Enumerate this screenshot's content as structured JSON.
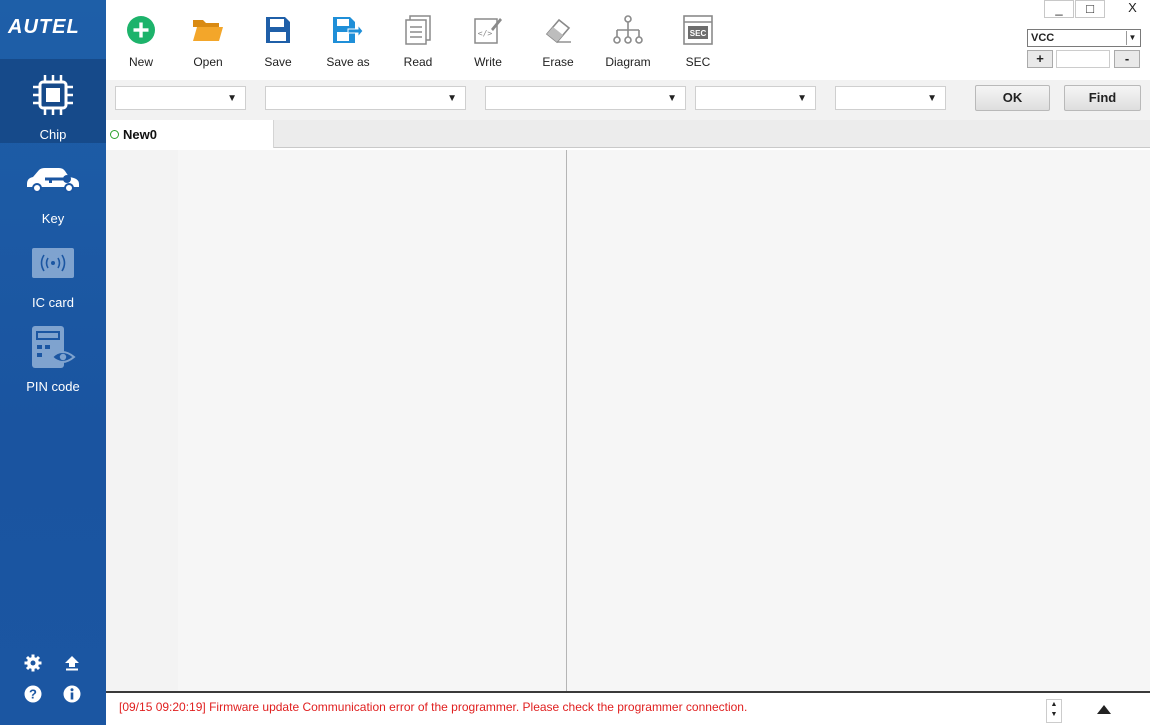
{
  "app": {
    "logo": "AUTEL"
  },
  "sidebar": {
    "items": [
      {
        "label": "Chip",
        "icon": "chip-icon",
        "active": true
      },
      {
        "label": "Key",
        "icon": "car-key-icon",
        "active": false
      },
      {
        "label": "IC card",
        "icon": "ic-card-icon",
        "active": false
      },
      {
        "label": "PIN code",
        "icon": "pin-code-icon",
        "active": false
      }
    ],
    "bottom_icons": [
      "settings-icon",
      "upgrade-icon",
      "help-icon",
      "info-icon"
    ]
  },
  "toolbar": {
    "items": [
      {
        "label": "New",
        "icon": "new-icon"
      },
      {
        "label": "Open",
        "icon": "open-folder-icon"
      },
      {
        "label": "Save",
        "icon": "save-icon"
      },
      {
        "label": "Save as",
        "icon": "save-as-icon"
      },
      {
        "label": "Read",
        "icon": "read-icon"
      },
      {
        "label": "Write",
        "icon": "write-icon"
      },
      {
        "label": "Erase",
        "icon": "erase-icon"
      },
      {
        "label": "Diagram",
        "icon": "diagram-icon"
      },
      {
        "label": "SEC",
        "icon": "sec-icon"
      }
    ],
    "sec_badge": "SEC"
  },
  "window": {
    "minimize": "_",
    "maximize": "□",
    "close": "X"
  },
  "vcc": {
    "selected": "VCC",
    "plus": "+",
    "minus": "-",
    "value": ""
  },
  "filters": {
    "dropdowns": [
      "",
      "",
      "",
      "",
      ""
    ],
    "ok_label": "OK",
    "find_label": "Find"
  },
  "tabs": [
    {
      "label": "New0",
      "status_color": "#2aa12a"
    }
  ],
  "status": {
    "message": "[09/15 09:20:19] Firmware update Communication error of the programmer. Please check the programmer connection.",
    "color": "#e02020"
  },
  "colors": {
    "sidebar": "#1b56a2",
    "sidebar_active": "#164a8a",
    "accent_green": "#1db36b",
    "folder": "#f0a020",
    "save_blue": "#1f5fa8"
  }
}
